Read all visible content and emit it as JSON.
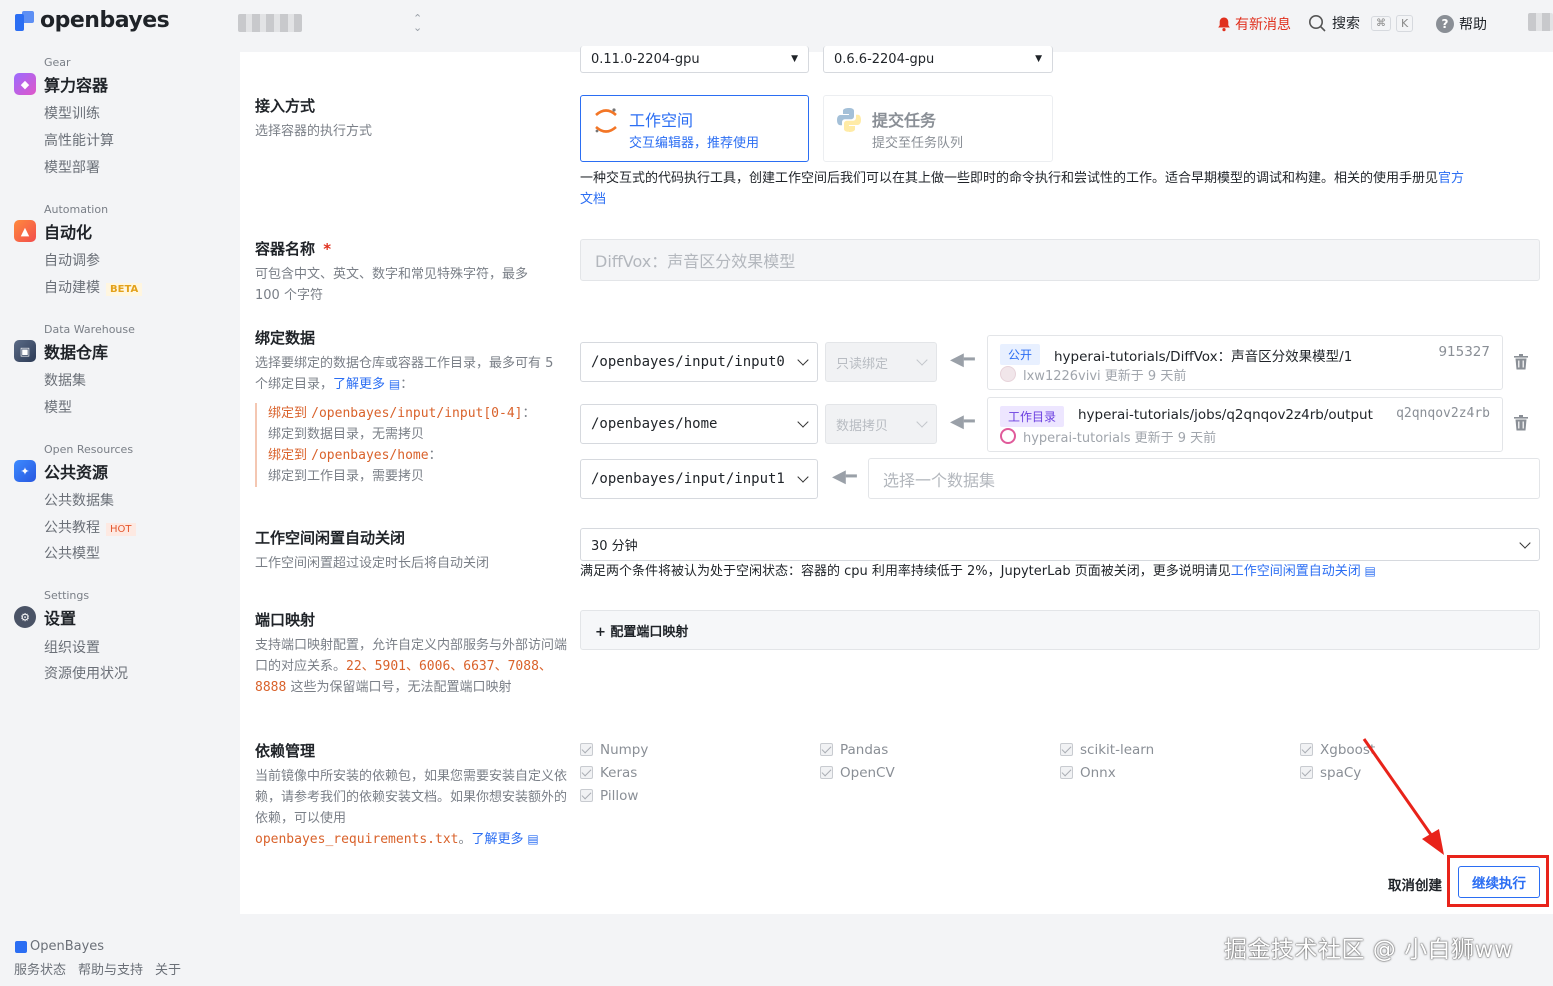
{
  "topbar": {
    "logo_text": "openbayes",
    "notice_label": "有新消息",
    "search_label": "搜索",
    "kbd_cmd": "⌘",
    "kbd_k": "K",
    "help_label": "帮助"
  },
  "sidebar": {
    "groups": [
      {
        "caption": "Gear",
        "title": "算力容器",
        "items": [
          "模型训练",
          "高性能计算",
          "模型部署"
        ]
      },
      {
        "caption": "Automation",
        "title": "自动化",
        "items": [
          "自动调参",
          "自动建模"
        ],
        "badge": "BETA"
      },
      {
        "caption": "Data Warehouse",
        "title": "数据仓库",
        "items": [
          "数据集",
          "模型"
        ]
      },
      {
        "caption": "Open Resources",
        "title": "公共资源",
        "items": [
          "公共数据集",
          "公共教程",
          "公共模型"
        ],
        "badge": "HOT"
      },
      {
        "caption": "Settings",
        "title": "设置",
        "items": [
          "组织设置",
          "资源使用状况"
        ]
      }
    ],
    "footer": {
      "brand": "OpenBayes",
      "links": [
        "服务状态",
        "帮助与支持",
        "关于"
      ]
    }
  },
  "images": {
    "first": "0.11.0-2204-gpu",
    "second": "0.6.6-2204-gpu"
  },
  "access": {
    "title": "接入方式",
    "desc": "选择容器的执行方式",
    "workspace": {
      "title": "工作空间",
      "sub": "交互编辑器，推荐使用"
    },
    "task": {
      "title": "提交任务",
      "sub": "提交至任务队列"
    },
    "note": "一种交互式的代码执行工具，创建工作空间后我们可以在其上做一些即时的命令执行和尝试性的工作。适合早期模型的调试和构建。相关的使用手册见",
    "note_link_a": "官方",
    "note_link_b": "文档"
  },
  "container_name": {
    "title": "容器名称",
    "required_mark": "*",
    "desc": "可包含中文、英文、数字和常见特殊字符，最多 100 个字符",
    "value": "DiffVox：声音区分效果模型"
  },
  "bind": {
    "title": "绑定数据",
    "desc": "选择要绑定的数据仓库或容器工作目录，最多可有 5 个绑定目录，",
    "learn_more": "了解更多",
    "hint1_prefix": "绑定到",
    "hint1_path": "/openbayes/input/input[0-4]",
    "hint1_suffix": "：",
    "hint1_sub": "绑定到数据目录，无需拷贝",
    "hint2_prefix": "绑定到",
    "hint2_path": "/openbayes/home",
    "hint2_suffix": "：",
    "hint2_sub": "绑定到工作目录，需要拷贝",
    "rows": [
      {
        "path": "/openbayes/input/input0",
        "mode": "只读绑定",
        "badge": "公开",
        "name": "hyperai-tutorials/DiffVox：声音区分效果模型/1",
        "id": "915327",
        "owner": "lxw1226vivi",
        "updated": "更新于 9 天前"
      },
      {
        "path": "/openbayes/home",
        "mode": "数据拷贝",
        "badge": "工作目录",
        "name": "hyperai-tutorials/jobs/q2qnqov2z4rb/output",
        "id": "q2qnqov2z4rb",
        "owner": "hyperai-tutorials",
        "updated": "更新于 9 天前"
      },
      {
        "path": "/openbayes/input/input1",
        "placeholder": "选择一个数据集"
      }
    ]
  },
  "idle": {
    "title": "工作空间闲置自动关闭",
    "desc": "工作空间闲置超过设定时长后将自动关闭",
    "value": "30 分钟",
    "note": "满足两个条件将被认为处于空闲状态：容器的 cpu 利用率持续低于 2%，JupyterLab 页面被关闭，更多说明请见",
    "note_link": "工作空间闲置自动关闭"
  },
  "ports": {
    "title": "端口映射",
    "desc_a": "支持端口映射配置，允许自定义内部服务与外部访问端口的对应关系。",
    "reserved": "22、5901、6006、6637、7088、8888",
    "desc_b": " 这些为保留端口号，无法配置端口映射",
    "button": "+ 配置端口映射"
  },
  "deps": {
    "title": "依赖管理",
    "desc": "当前镜像中所安装的依赖包，如果您需要安装自定义依赖，请参考我们的依赖安装文档。如果你想安装额外的依赖，可以使用",
    "file": "openbayes_requirements.txt",
    "sep": "。",
    "learn_more": "了解更多",
    "packages": [
      "Numpy",
      "Pandas",
      "scikit-learn",
      "Xgboost",
      "Keras",
      "OpenCV",
      "Onnx",
      "spaCy",
      "Pillow"
    ]
  },
  "actions": {
    "cancel": "取消创建",
    "continue": "继续执行"
  },
  "watermark": "掘金技术社区 @ 小白狮ww",
  "colors": {
    "accent": "#2b6ef3",
    "danger": "#e0301e",
    "code": "#d9622b"
  }
}
